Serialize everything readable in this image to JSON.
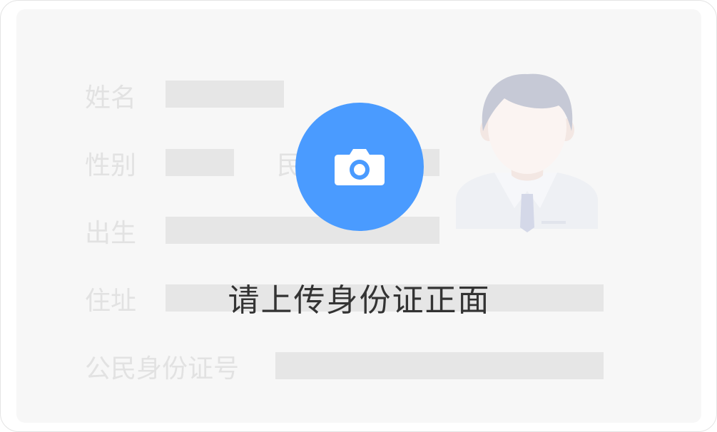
{
  "id_card": {
    "fields": {
      "name": "姓名",
      "gender": "性别",
      "ethnicity": "民",
      "birth": "出生",
      "address": "住址",
      "id_number": "公民身份证号"
    }
  },
  "upload": {
    "icon": "camera-icon",
    "prompt": "请上传身份证正面",
    "button_color": "#4a9bff"
  },
  "portrait": {
    "icon": "person-avatar-icon"
  }
}
